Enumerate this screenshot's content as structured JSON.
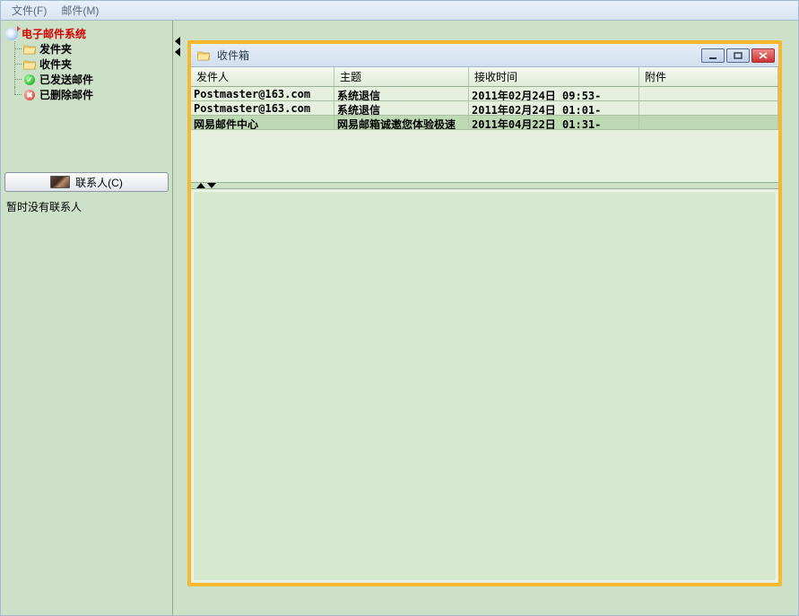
{
  "menu": {
    "file": "文件(F)",
    "mail": "邮件(M)"
  },
  "tree": {
    "root": "电子邮件系统",
    "outbox": "发件夹",
    "inbox": "收件夹",
    "sent": "已发送邮件",
    "deleted": "已删除邮件"
  },
  "contacts": {
    "button": "联系人(C)",
    "empty": "暂时没有联系人"
  },
  "inboxWindow": {
    "title": "收件箱"
  },
  "columns": {
    "sender": "发件人",
    "subject": "主题",
    "time": "接收时间",
    "attach": "附件"
  },
  "mails": [
    {
      "sender": "Postmaster@163.com",
      "subject": "系统退信",
      "time": "2011年02月24日 09:53-",
      "attach": ""
    },
    {
      "sender": "Postmaster@163.com",
      "subject": "系统退信",
      "time": "2011年02月24日 01:01-",
      "attach": ""
    },
    {
      "sender": "网易邮件中心",
      "subject": "网易邮箱诚邀您体验极速",
      "time": "2011年04月22日 01:31-",
      "attach": ""
    }
  ]
}
